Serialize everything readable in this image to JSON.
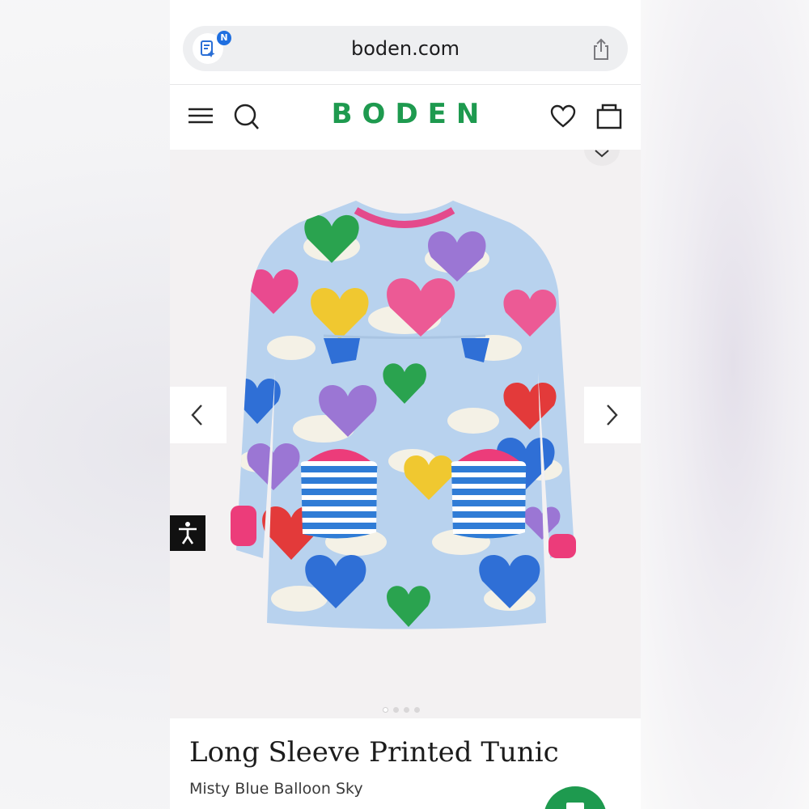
{
  "browser": {
    "url": "boden.com",
    "reader_badge": "N"
  },
  "header": {
    "logo": "BODEN"
  },
  "gallery": {
    "image_count": 4,
    "active_index": 0
  },
  "product": {
    "title": "Long Sleeve Printed Tunic",
    "color_name": "Misty Blue Balloon Sky"
  },
  "colors": {
    "brand_green": "#1e9a4f",
    "tunic_blue": "#b8d2ee",
    "gallery_bg": "#f3f1f2"
  },
  "icons": [
    "reader-icon",
    "share-icon",
    "menu-icon",
    "search-icon",
    "heart-icon",
    "bag-icon",
    "chevron-down-icon",
    "chevron-left-icon",
    "chevron-right-icon",
    "accessibility-icon"
  ]
}
